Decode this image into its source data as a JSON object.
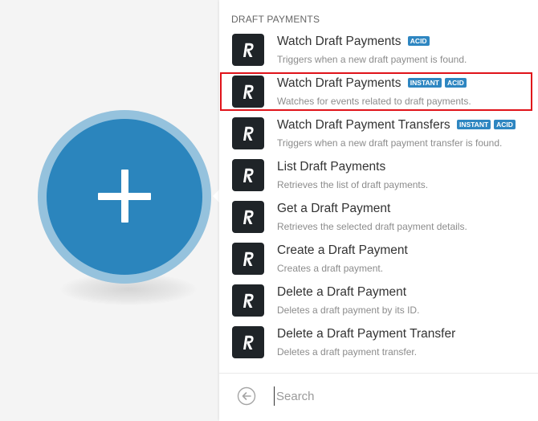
{
  "panel": {
    "section_header": "DRAFT PAYMENTS",
    "items": [
      {
        "title": "Watch Draft Payments",
        "badges": [
          "ACID"
        ],
        "description": "Triggers when a new draft payment is found."
      },
      {
        "title": "Watch Draft Payments",
        "badges": [
          "INSTANT",
          "ACID"
        ],
        "description": "Watches for events related to draft payments.",
        "highlighted": true
      },
      {
        "title": "Watch Draft Payment Transfers",
        "badges": [
          "INSTANT",
          "ACID"
        ],
        "description": "Triggers when a new draft payment transfer is found."
      },
      {
        "title": "List Draft Payments",
        "badges": [],
        "description": "Retrieves the list of draft payments."
      },
      {
        "title": "Get a Draft Payment",
        "badges": [],
        "description": "Retrieves the selected draft payment details."
      },
      {
        "title": "Create a Draft Payment",
        "badges": [],
        "description": "Creates a draft payment."
      },
      {
        "title": "Delete a Draft Payment",
        "badges": [],
        "description": "Deletes a draft payment by its ID."
      },
      {
        "title": "Delete a Draft Payment Transfer",
        "badges": [],
        "description": "Deletes a draft payment transfer."
      }
    ]
  },
  "search": {
    "placeholder": "Search",
    "value": ""
  },
  "colors": {
    "accent": "#2b85bd",
    "badge": "#2e86c1",
    "highlight": "#e0131a",
    "app_icon": "#1f2428"
  },
  "icons": {
    "app": "revolut-r-icon",
    "back": "back-arrow-icon",
    "add": "plus-icon"
  }
}
